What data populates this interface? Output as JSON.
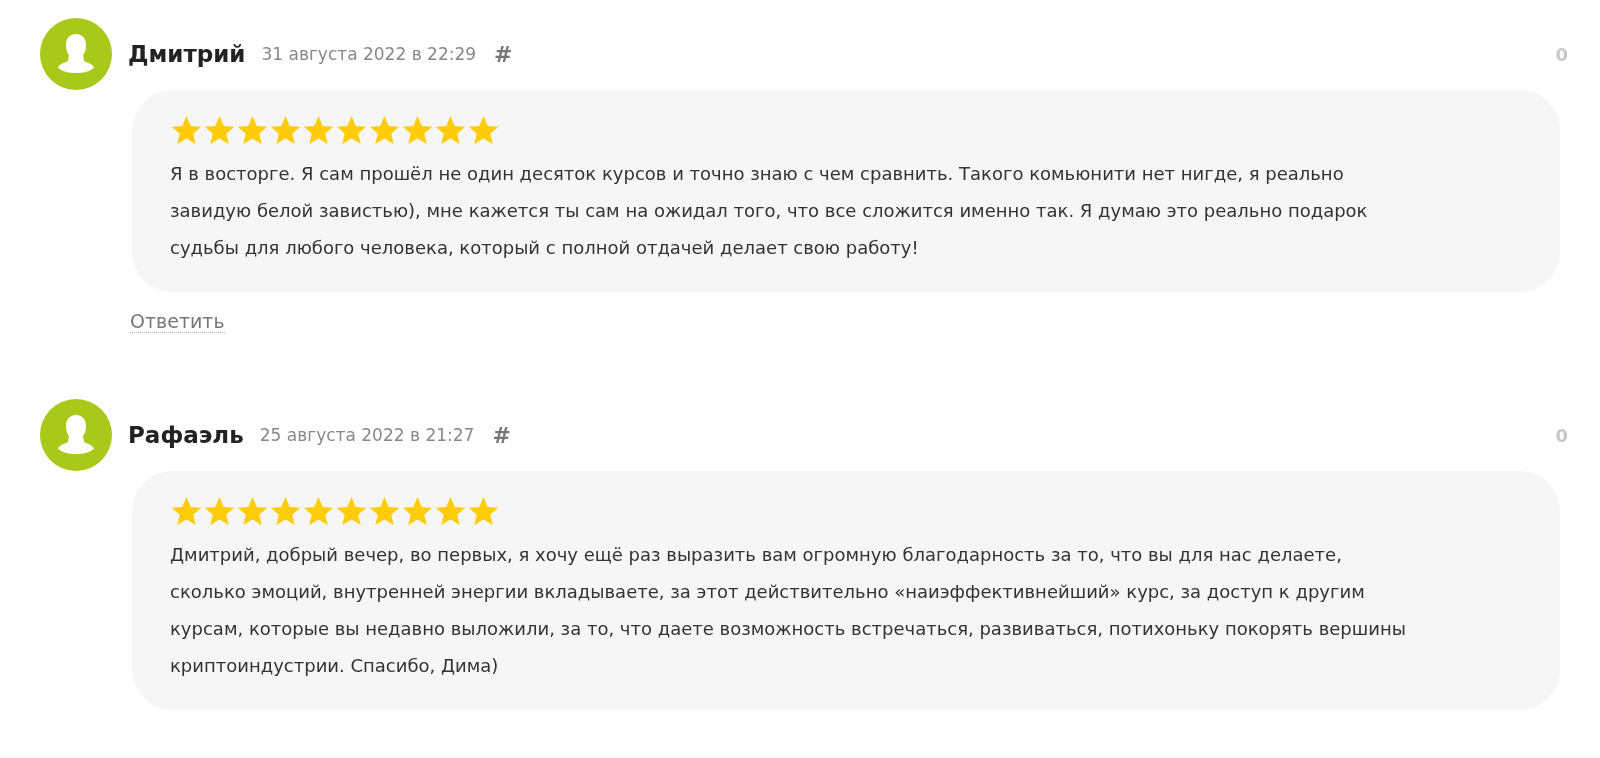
{
  "comments": [
    {
      "author": "Дмитрий",
      "date": "31 августа 2022 в 22:29",
      "anchor": "#",
      "votes": "0",
      "stars": 10,
      "text": "Я в восторге. Я сам прошёл не один десяток курсов и точно знаю с чем сравнить. Такого комьюнити нет нигде, я реально завидую белой завистью), мне кажется ты сам на ожидал того, что все сложится именно так. Я думаю это реально подарок судьбы для любого человека, который с полной отдачей делает свою работу!",
      "reply": "Ответить"
    },
    {
      "author": "Рафаэль",
      "date": "25 августа 2022 в 21:27",
      "anchor": "#",
      "votes": "0",
      "stars": 10,
      "text": "Дмитрий, добрый вечер, во первых, я хочу ещё раз выразить вам огромную благодарность за то, что вы для нас делаете, сколько эмоций, внутренней энергии вкладываете, за этот действительно «наиэффективнейший» курс, за доступ к другим курсам, которые вы недавно выложили, за то, что даете возможность встречаться, развиваться, потихоньку покорять вершины криптоиндустрии. Спасибо, Дима)"
    }
  ]
}
